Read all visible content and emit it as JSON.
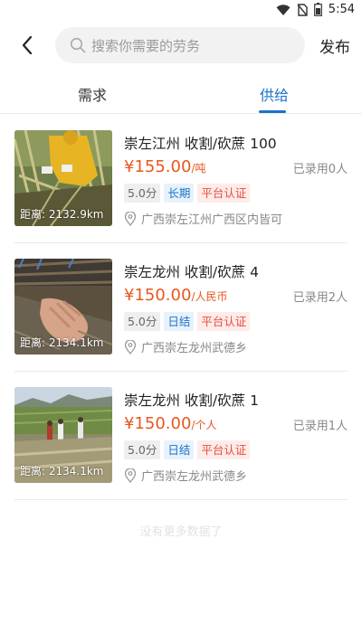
{
  "status_bar": {
    "time": "5:54"
  },
  "header": {
    "search_placeholder": "搜索你需要的劳务",
    "publish_label": "发布"
  },
  "tabs": [
    {
      "label": "需求"
    },
    {
      "label": "供给"
    }
  ],
  "listings": [
    {
      "title": "崇左江州 收割/砍蔗 100",
      "price": "¥155.00",
      "unit": "/吨",
      "hired": "已录用0人",
      "score": "5.0分",
      "tag_type": "长期",
      "tag_cert": "平台认证",
      "location": "广西崇左江州广西区内皆可",
      "distance": "距离: 2132.9km"
    },
    {
      "title": "崇左龙州 收割/砍蔗 4",
      "price": "¥150.00",
      "unit": "/人民币",
      "hired": "已录用2人",
      "score": "5.0分",
      "tag_type": "日结",
      "tag_cert": "平台认证",
      "location": "广西崇左龙州武德乡",
      "distance": "距离: 2134.1km"
    },
    {
      "title": "崇左龙州 收割/砍蔗 1",
      "price": "¥150.00",
      "unit": "/个人",
      "hired": "已录用1人",
      "score": "5.0分",
      "tag_type": "日结",
      "tag_cert": "平台认证",
      "location": "广西崇左龙州武德乡",
      "distance": "距离: 2134.1km"
    }
  ],
  "footer": {
    "no_more": "没有更多数据了"
  },
  "colors": {
    "accent": "#1a73c9",
    "price": "#e8571f",
    "cert": "#e54d3b"
  }
}
